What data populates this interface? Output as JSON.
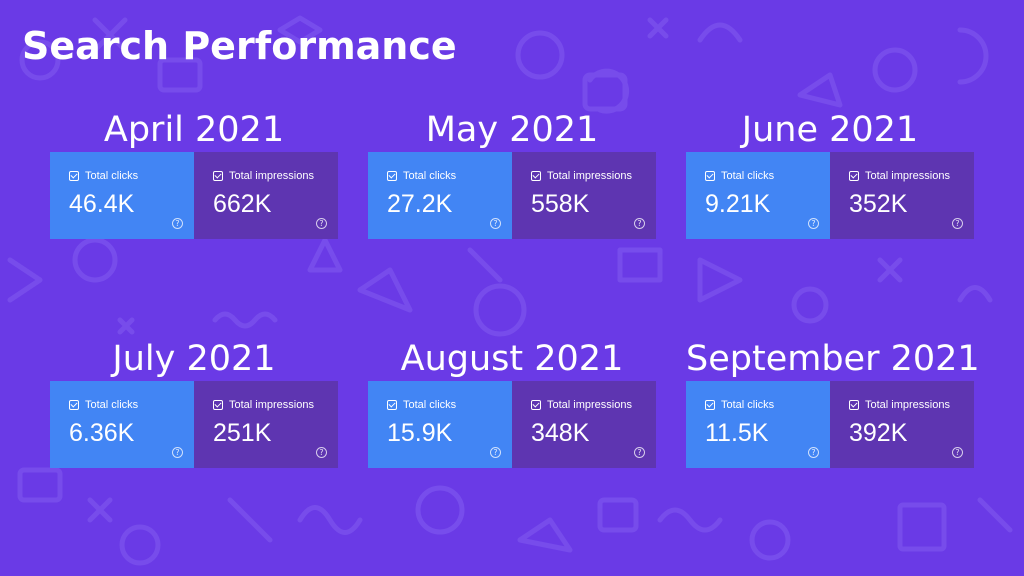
{
  "title": "Search Performance",
  "card_labels": {
    "clicks": "Total clicks",
    "impressions": "Total impressions"
  },
  "help_glyph": "?",
  "colors": {
    "background": "#6a3ae6",
    "clicks_card": "#4285f4",
    "impressions_card": "#5e35b1"
  },
  "months": [
    {
      "label": "April 2021",
      "clicks": "46.4K",
      "impressions": "662K"
    },
    {
      "label": "May 2021",
      "clicks": "27.2K",
      "impressions": "558K"
    },
    {
      "label": "June 2021",
      "clicks": "9.21K",
      "impressions": "352K"
    },
    {
      "label": "July 2021",
      "clicks": "6.36K",
      "impressions": "251K"
    },
    {
      "label": "August 2021",
      "clicks": "15.9K",
      "impressions": "348K"
    },
    {
      "label": "September 2021",
      "clicks": "11.5K",
      "impressions": "392K"
    }
  ]
}
